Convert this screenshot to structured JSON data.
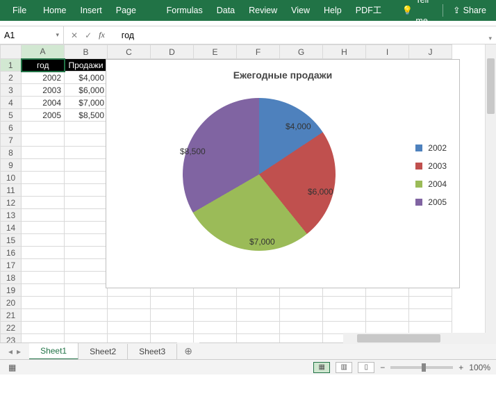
{
  "ribbon": {
    "file": "File",
    "home": "Home",
    "insert": "Insert",
    "pageLayout": "Page Layout",
    "formulas": "Formulas",
    "data": "Data",
    "review": "Review",
    "view": "View",
    "help": "Help",
    "pdf": "PDF工具集",
    "tellme": "Tell me",
    "share": "Share"
  },
  "namebox": {
    "value": "A1"
  },
  "formula_bar": {
    "value": "год"
  },
  "columns": [
    "A",
    "B",
    "C",
    "D",
    "E",
    "F",
    "G",
    "H",
    "I",
    "J"
  ],
  "row_count": 25,
  "table": {
    "headers": {
      "a": "год",
      "b": "Продажи"
    },
    "rows": [
      {
        "a": "2002",
        "b": "$4,000"
      },
      {
        "a": "2003",
        "b": "$6,000"
      },
      {
        "a": "2004",
        "b": "$7,000"
      },
      {
        "a": "2005",
        "b": "$8,500"
      }
    ]
  },
  "chart_data": {
    "type": "pie",
    "title": "Ежегодные продажи",
    "categories": [
      "2002",
      "2003",
      "2004",
      "2005"
    ],
    "values": [
      4000,
      6000,
      7000,
      8500
    ],
    "data_labels": [
      "$4,000",
      "$6,000",
      "$7,000",
      "$8,500"
    ],
    "colors": [
      "#4e81bd",
      "#c0504e",
      "#9bbb58",
      "#8064a2"
    ],
    "legend_position": "right"
  },
  "tabs": {
    "active": "Sheet1",
    "items": [
      "Sheet1",
      "Sheet2",
      "Sheet3"
    ]
  },
  "status": {
    "zoom": "100%"
  },
  "zoom_ctrl": {
    "minus": "−",
    "plus": "+"
  }
}
